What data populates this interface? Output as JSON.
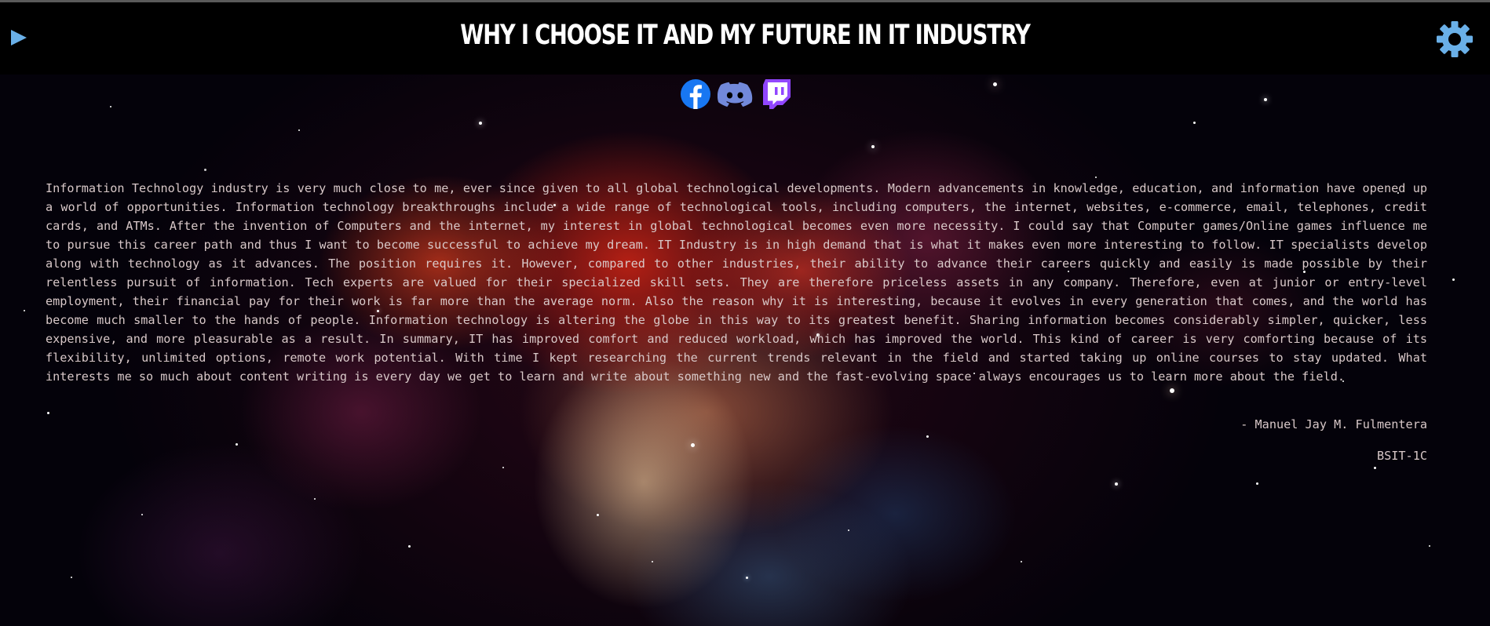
{
  "header": {
    "title": "WHY I CHOOSE IT AND MY FUTURE IN IT INDUSTRY",
    "play_icon": "play-icon",
    "settings_icon": "gear-icon"
  },
  "social_links": [
    {
      "name": "Facebook",
      "icon": "facebook-icon",
      "color": "#1877f2"
    },
    {
      "name": "Discord",
      "icon": "discord-icon",
      "color": "#7289da"
    },
    {
      "name": "Twitch",
      "icon": "twitch-icon",
      "color": "#9146ff"
    }
  ],
  "essay": {
    "body": "Information Technology industry is very much close to me, ever since given to all global technological developments. Modern advancements in knowledge, education, and information have opened up a world of opportunities. Information technology breakthroughs include a wide range of technological tools, including computers, the internet, websites, e-commerce, email, telephones, credit cards, and ATMs. After the invention of Computers and the internet, my interest in global technological becomes even more necessity. I could say that Computer games/Online games influence me to pursue this career path and thus I want to become successful to achieve my dream. IT Industry is in high demand that is what it makes even more interesting to follow. IT specialists develop along with technology as it advances. The position requires it. However, compared to other industries, their ability to advance their careers quickly and easily is made possible by their relentless pursuit of information. Tech experts are valued for their specialized skill sets. They are therefore priceless assets in any company. Therefore, even at junior or entry-level employment, their financial pay for their work is far more than the average norm. Also the reason why it is interesting, because it evolves in every generation that comes, and the world has become much smaller to the hands of people. Information technology is altering the globe in this way to its greatest benefit. Sharing information becomes considerably simpler, quicker, less expensive, and more pleasurable as a result. In summary, IT has improved comfort and reduced workload, which has improved the world. This kind of career is very comforting because of its flexibility, unlimited options, remote work potential. With time I kept researching the current trends relevant in the field and started taking up online courses to stay updated. What interests me so much about content writing is every day we get to learn and write about something new and the fast-evolving space always encourages us to learn more about the field.",
    "author": "- Manuel Jay M. Fulmentera",
    "section": "BSIT-1C"
  },
  "colors": {
    "header_bg": "#000000",
    "accent_blue": "#6ab0e8",
    "text": "#d8c8c8"
  }
}
